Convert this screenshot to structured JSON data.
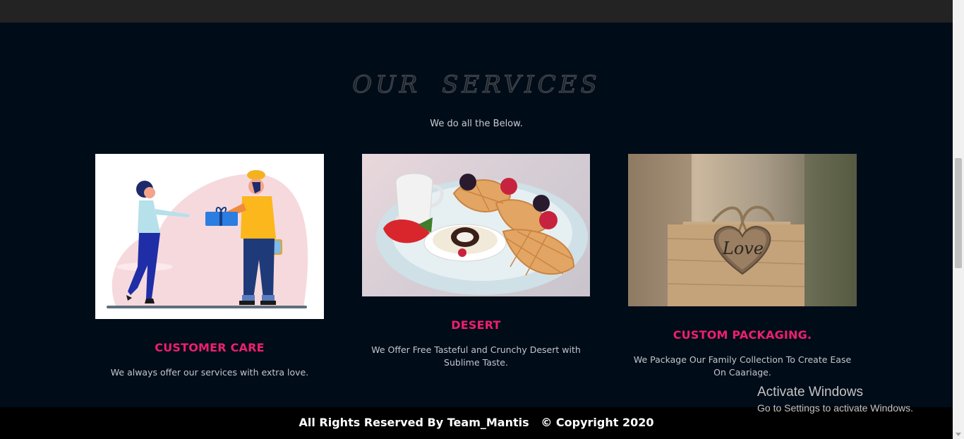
{
  "section": {
    "title": "OUR   SERVICES",
    "subtitle": "We do all the Below."
  },
  "cards": [
    {
      "image": "customer-care-illustration",
      "title": "CUSTOMER CARE",
      "desc": "We always offer our services with extra love."
    },
    {
      "image": "waffle-dessert-photo",
      "title": "DESERT",
      "desc": "We Offer Free Tasteful and Crunchy Desert with Sublime Taste."
    },
    {
      "image": "love-gift-box-photo",
      "title": "CUSTOM PACKAGING.",
      "desc": "We Package Our Family Collection To Create Ease On Caariage."
    }
  ],
  "footer": {
    "text": "All Rights Reserved By Team_Mantis   © Copyright 2020"
  },
  "watermark": {
    "title": "Activate Windows",
    "subtitle": "Go to Settings to activate Windows."
  },
  "colors": {
    "background": "#010c19",
    "accent": "#ee1f6e",
    "footer": "#000000"
  },
  "icons": [
    "love-heart-icon"
  ],
  "decor_text": {
    "gift_label": "Love"
  }
}
